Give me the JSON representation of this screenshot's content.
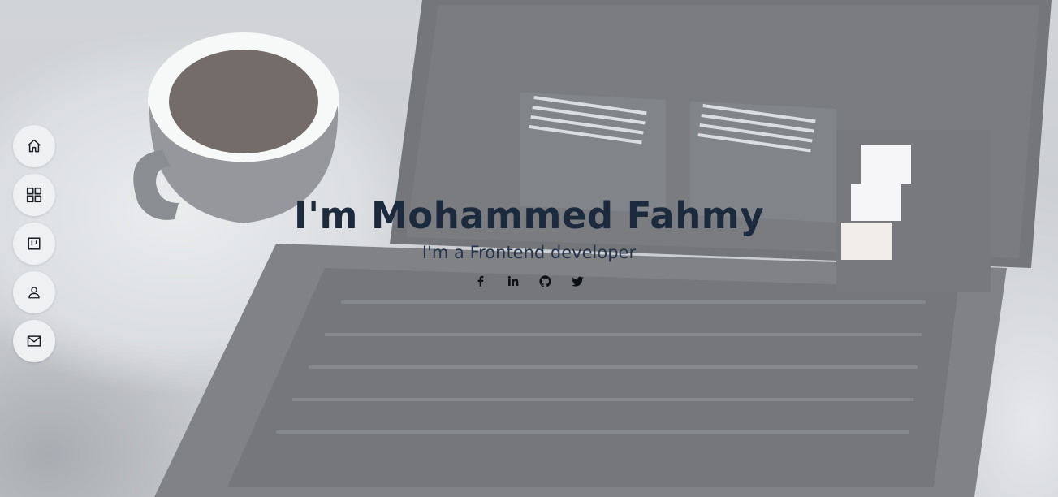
{
  "hero": {
    "title": "I'm Mohammed Fahmy",
    "subtitle": "I'm a Frontend developer"
  },
  "social": [
    {
      "name": "facebook",
      "icon": "facebook-icon"
    },
    {
      "name": "linkedin",
      "icon": "linkedin-icon"
    },
    {
      "name": "github",
      "icon": "github-icon"
    },
    {
      "name": "twitter",
      "icon": "twitter-icon"
    }
  ],
  "nav": [
    {
      "name": "home",
      "icon": "home-icon"
    },
    {
      "name": "portfolio",
      "icon": "grid-icon"
    },
    {
      "name": "projects",
      "icon": "board-icon"
    },
    {
      "name": "about",
      "icon": "user-icon"
    },
    {
      "name": "contact",
      "icon": "mail-icon"
    }
  ],
  "colors": {
    "title": "#1c2a3d",
    "subtitle": "#26344a",
    "nav_bg": "#eef0f2"
  }
}
